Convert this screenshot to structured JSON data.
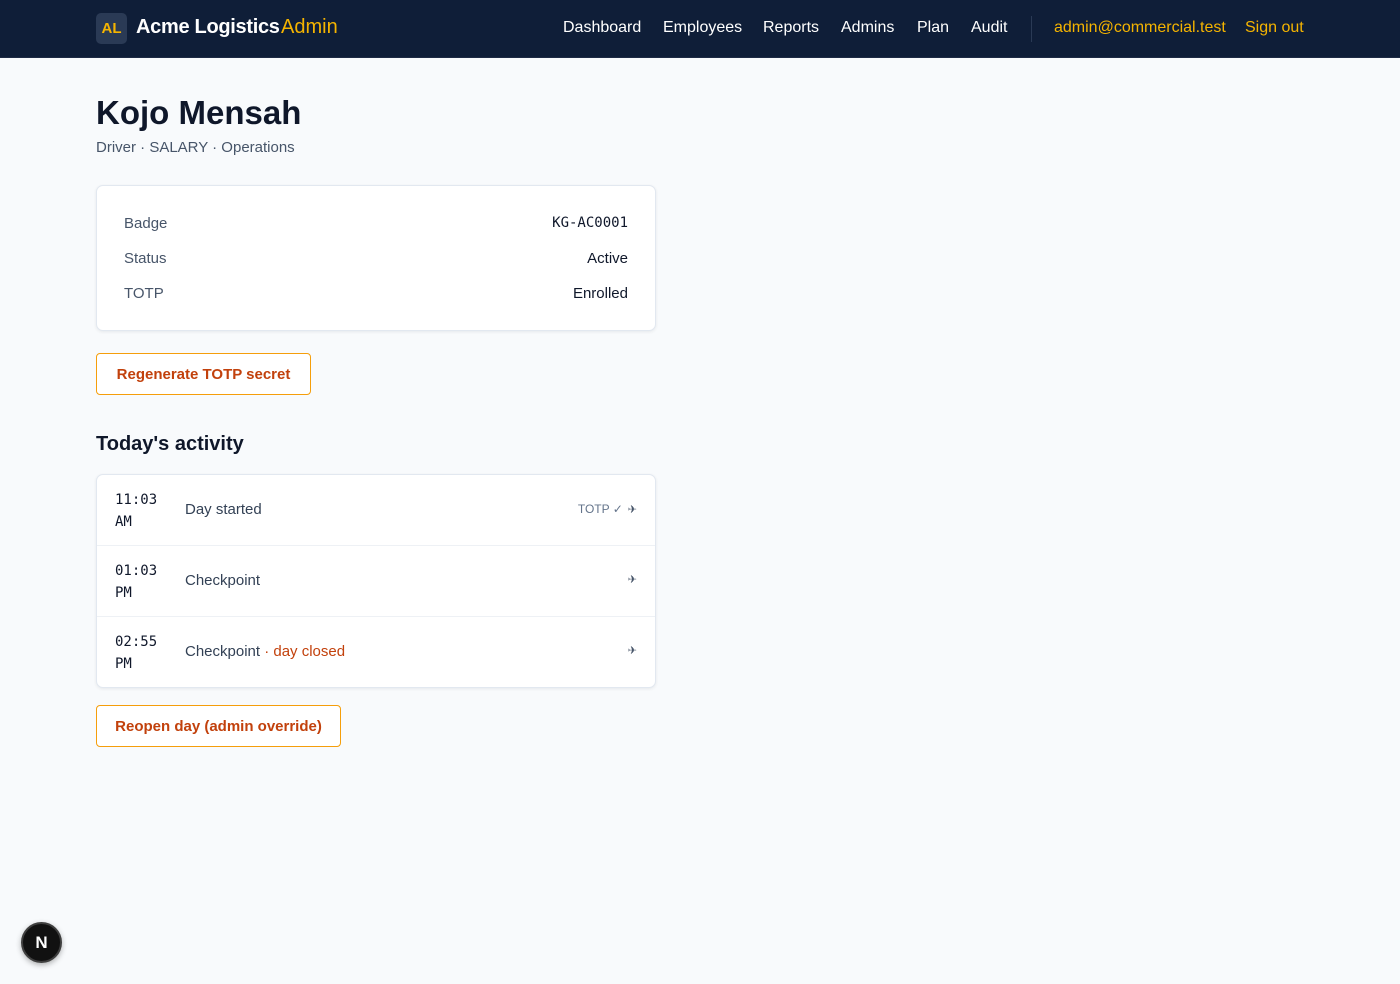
{
  "header": {
    "logo_text": "AL",
    "brand": "Acme Logistics",
    "brand_suffix": "Admin",
    "nav": [
      {
        "label": "Dashboard"
      },
      {
        "label": "Employees"
      },
      {
        "label": "Reports"
      },
      {
        "label": "Admins"
      },
      {
        "label": "Plan"
      },
      {
        "label": "Audit"
      }
    ],
    "user_email": "admin@commercial.test",
    "sign_out": "Sign out"
  },
  "employee": {
    "name": "Kojo Mensah",
    "subtitle": "Driver · SALARY · Operations",
    "fields": [
      {
        "label": "Badge",
        "value": "KG-AC0001"
      },
      {
        "label": "Status",
        "value": "Active"
      },
      {
        "label": "TOTP",
        "value": "Enrolled"
      }
    ],
    "regenerate_button": "Regenerate TOTP secret"
  },
  "activity": {
    "title": "Today's activity",
    "items": [
      {
        "time": "11:03",
        "period": "AM",
        "label": "Day started",
        "suffix": "",
        "meta": "TOTP ✓",
        "icon": "pin-icon"
      },
      {
        "time": "01:03",
        "period": "PM",
        "label": "Checkpoint",
        "suffix": "",
        "meta": "",
        "icon": "pin-icon"
      },
      {
        "time": "02:55",
        "period": "PM",
        "label": "Checkpoint",
        "suffix": " · day closed",
        "meta": "",
        "icon": "pin-icon"
      }
    ],
    "reopen_button": "Reopen day (admin override)"
  },
  "dev_badge": {
    "letter": "N"
  },
  "colors": {
    "header_bg": "#0f1e38",
    "accent": "#f5b400",
    "button_text": "#c2410c",
    "button_border": "#f59e0b",
    "page_bg": "#f8fafc"
  }
}
